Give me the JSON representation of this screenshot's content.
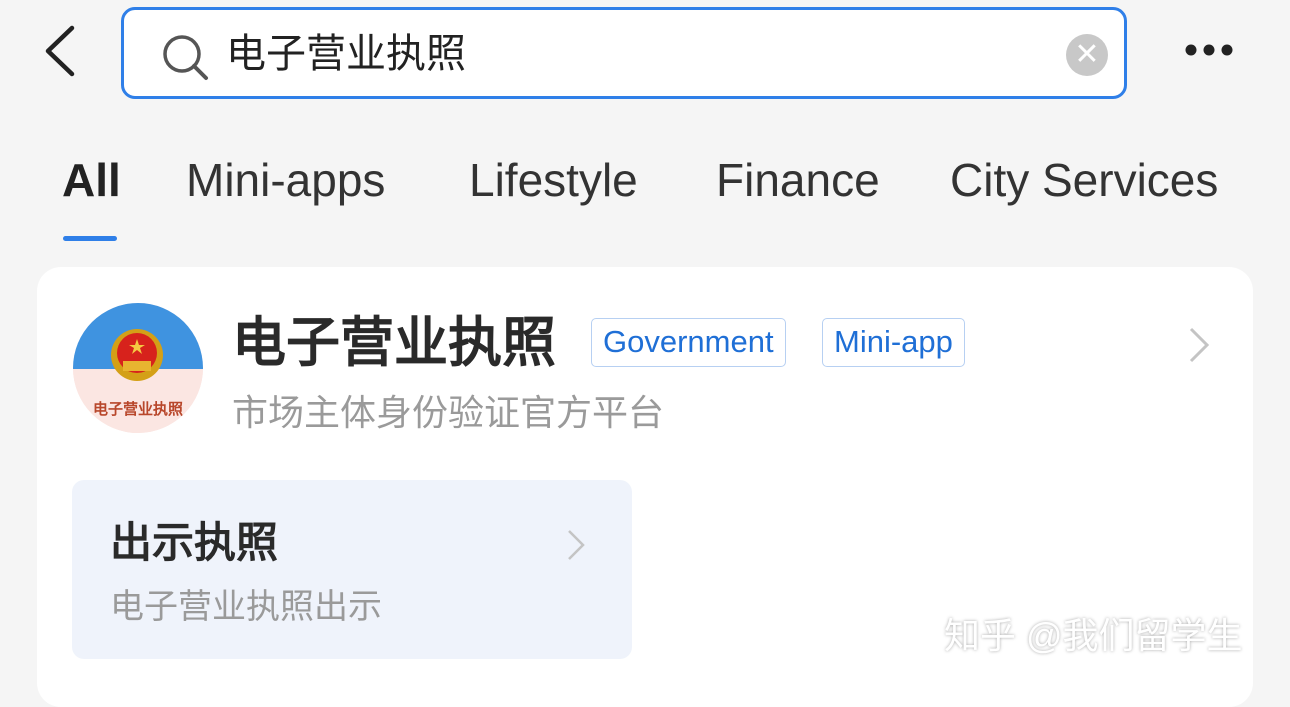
{
  "header": {
    "search_query": "电子营业执照",
    "icons": [
      "back-icon",
      "search-icon",
      "clear-icon",
      "more-icon"
    ]
  },
  "tabs": [
    {
      "label": "All",
      "active": true
    },
    {
      "label": "Mini-apps"
    },
    {
      "label": "Lifestyle"
    },
    {
      "label": "Finance"
    },
    {
      "label": "City Services"
    }
  ],
  "result": {
    "title": "电子营业执照",
    "tags": [
      "Government",
      "Mini-app"
    ],
    "subtitle": "市场主体身份验证官方平台",
    "logo_text": "电子营业执照",
    "service": {
      "title": "出示执照",
      "subtitle": "电子营业执照出示"
    }
  },
  "watermark": "知乎 @我们留学生",
  "colors": {
    "accent": "#2f7fe8",
    "background": "#f5f5f5"
  }
}
